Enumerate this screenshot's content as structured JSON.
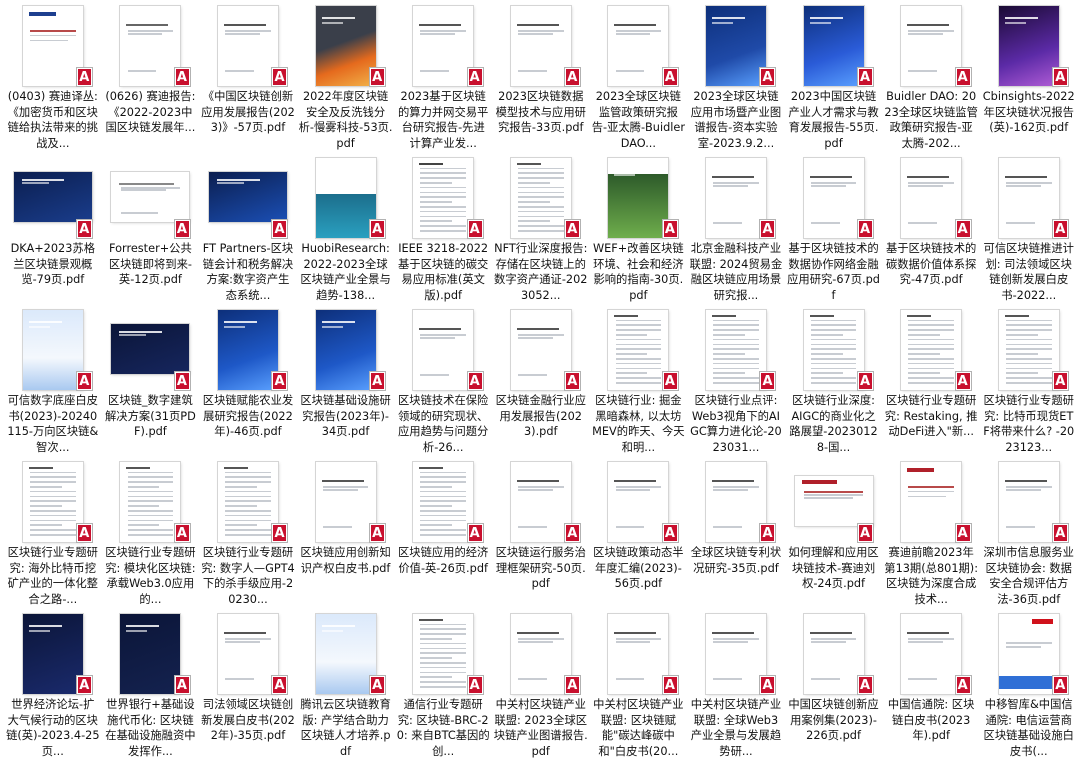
{
  "files": [
    {
      "name": "(0403) 赛迪译丛: 《加密货币和区块链给执法带来的挑战及...",
      "thumb": {
        "style": "report",
        "accent": "#1d3f8f"
      }
    },
    {
      "name": "(0626) 赛迪报告: 《2022-2023中国区块链发展年...",
      "thumb": {
        "style": "plain",
        "accent": "#666666"
      }
    },
    {
      "name": "《中国区块链创新应用发展报告(2023)》-57页.pdf",
      "thumb": {
        "style": "plain",
        "accent": "#555555"
      }
    },
    {
      "name": "2022年度区块链安全及反洗钱分析-慢雾科技-53页.pdf",
      "thumb": {
        "style": "orange",
        "accent": "#e56a1d"
      }
    },
    {
      "name": "2023基于区块链的算力并网交易平台研究报告-先进计算产业发...",
      "thumb": {
        "style": "plain",
        "accent": "#555555"
      }
    },
    {
      "name": "2023区块链数据模型技术与应用研究报告-33页.pdf",
      "thumb": {
        "style": "plain",
        "accent": "#555555"
      }
    },
    {
      "name": "2023全球区块链监管政策研究报告-亚太腾-Buidler DAO...",
      "thumb": {
        "style": "plain",
        "accent": "#555555"
      }
    },
    {
      "name": "2023全球区块链应用市场暨产业图谱报告-资本实验室-2023.9.2...",
      "thumb": {
        "style": "blue",
        "accent": "#1f4aa8"
      }
    },
    {
      "name": "2023中国区块链产业人才需求与教育发展报告-55页.pdf",
      "thumb": {
        "style": "blue",
        "accent": "#2a5bd7"
      }
    },
    {
      "name": "Buidler DAO: 2023全球区块链监管政策研究报告-亚太腾-202...",
      "thumb": {
        "style": "plain",
        "accent": "#555555"
      }
    },
    {
      "name": "Cbinsights-2022年区块链状况报告(英)-162页.pdf",
      "thumb": {
        "style": "purple",
        "accent": "#5b2aa6"
      }
    },
    {
      "name": "DKA+2023苏格兰区块链景观概览-79页.pdf",
      "thumb": {
        "style": "land-blue",
        "accent": "#1a3d8c"
      }
    },
    {
      "name": "Forrester+公共区块链即将到来-英-12页.pdf",
      "thumb": {
        "style": "land-plain",
        "accent": "#888888"
      }
    },
    {
      "name": "FT Partners-区块链会计和税务解决方案:数字资产生态系统...",
      "thumb": {
        "style": "land-blue",
        "accent": "#1b4fb5"
      }
    },
    {
      "name": "HuobiResearch: 2022-2023全球区块链产业全景与趋势-138...",
      "thumb": {
        "style": "teal",
        "accent": "#1c6e8c"
      }
    },
    {
      "name": "IEEE 3218-2022 基于区块链的碳交易应用标准(英文版).pdf",
      "thumb": {
        "style": "standard",
        "accent": "#444444"
      }
    },
    {
      "name": "NFT行业深度报告: 存储在区块链上的数字资产通证-2023052...",
      "thumb": {
        "style": "dense",
        "accent": "#555555"
      }
    },
    {
      "name": "WEF+改善区块链环境、社会和经济影响的指南-30页.pdf",
      "thumb": {
        "style": "green",
        "accent": "#3a7d2c"
      }
    },
    {
      "name": "北京金融科技产业联盟: 2024贸易金融区块链应用场景研究报...",
      "thumb": {
        "style": "plain",
        "accent": "#555555"
      }
    },
    {
      "name": "基于区块链技术的数据协作网络金融应用研究-67页.pdf",
      "thumb": {
        "style": "plain",
        "accent": "#555555"
      }
    },
    {
      "name": "基于区块链技术的碳数据价值体系探究-47页.pdf",
      "thumb": {
        "style": "plain",
        "accent": "#555555"
      }
    },
    {
      "name": "可信区块链推进计划: 司法领域区块链创新发展白皮书-2022...",
      "thumb": {
        "style": "plain",
        "accent": "#555555"
      }
    },
    {
      "name": "可信数字底座白皮书(2023)-20240115-万向区块链&智次...",
      "thumb": {
        "style": "lightblue",
        "accent": "#4a90e2"
      }
    },
    {
      "name": "区块链_数字建筑解决方案(31页PDF).pdf",
      "thumb": {
        "style": "land-navy",
        "accent": "#16265e"
      }
    },
    {
      "name": "区块链赋能农业发展研究报告(2022年)-46页.pdf",
      "thumb": {
        "style": "blue",
        "accent": "#1e58c7"
      }
    },
    {
      "name": "区块链基础设施研究报告(2023年)-34页.pdf",
      "thumb": {
        "style": "blue",
        "accent": "#1e58c7"
      }
    },
    {
      "name": "区块链技术在保险领域的研究现状、应用趋势与问题分析-26...",
      "thumb": {
        "style": "plain",
        "accent": "#555555"
      }
    },
    {
      "name": "区块链金融行业应用发展报告(2023).pdf",
      "thumb": {
        "style": "plain",
        "accent": "#555555"
      }
    },
    {
      "name": "区块链行业: 掘金黑暗森林, 以太坊MEV的昨天、今天和明...",
      "thumb": {
        "style": "dense",
        "accent": "#555555"
      }
    },
    {
      "name": "区块链行业点评: Web3视角下的AIGC算力进化论-2023031...",
      "thumb": {
        "style": "dense",
        "accent": "#555555"
      }
    },
    {
      "name": "区块链行业深度: AIGC的商业化之路展望-20230128-国...",
      "thumb": {
        "style": "dense",
        "accent": "#555555"
      }
    },
    {
      "name": "区块链行业专题研究: Restaking, 推动DeFi进入\"新...",
      "thumb": {
        "style": "dense",
        "accent": "#555555"
      }
    },
    {
      "name": "区块链行业专题研究: 比特币现货ETF将带来什么? -2023123...",
      "thumb": {
        "style": "dense",
        "accent": "#555555"
      }
    },
    {
      "name": "区块链行业专题研究: 海外比特币挖矿产业的一体化整合之路-...",
      "thumb": {
        "style": "dense",
        "accent": "#555555"
      }
    },
    {
      "name": "区块链行业专题研究: 模块化区块链: 承载Web3.0应用的...",
      "thumb": {
        "style": "dense",
        "accent": "#555555"
      }
    },
    {
      "name": "区块链行业专题研究: 数字人—GPT4下的杀手级应用-20230...",
      "thumb": {
        "style": "dense",
        "accent": "#555555"
      }
    },
    {
      "name": "区块链应用创新知识产权白皮书.pdf",
      "thumb": {
        "style": "plain",
        "accent": "#555555"
      }
    },
    {
      "name": "区块链应用的经济价值-英-26页.pdf",
      "thumb": {
        "style": "dense",
        "accent": "#555555"
      }
    },
    {
      "name": "区块链运行服务治理框架研究-50页.pdf",
      "thumb": {
        "style": "plain",
        "accent": "#555555"
      }
    },
    {
      "name": "区块链政策动态半年度汇编(2023)-56页.pdf",
      "thumb": {
        "style": "plain",
        "accent": "#555555"
      }
    },
    {
      "name": "全球区块链专利状况研究-35页.pdf",
      "thumb": {
        "style": "plain",
        "accent": "#555555"
      }
    },
    {
      "name": "如何理解和应用区块链技术-赛迪刘权-24页.pdf",
      "thumb": {
        "style": "land-report",
        "accent": "#b0202a"
      }
    },
    {
      "name": "赛迪前瞻2023年第13期(总801期): 区块链为深度合成技术...",
      "thumb": {
        "style": "report",
        "accent": "#b0202a"
      }
    },
    {
      "name": "深圳市信息服务业区块链协会: 数据安全合规评估方法-36页.pdf",
      "thumb": {
        "style": "plain",
        "accent": "#555555"
      }
    },
    {
      "name": "世界经济论坛-扩大气候行动的区块链(英)-2023.4-25页...",
      "thumb": {
        "style": "navy",
        "accent": "#1a2a6c"
      }
    },
    {
      "name": "世界银行+基础设施代币化: 区块链在基础设施融资中发挥作...",
      "thumb": {
        "style": "navy",
        "accent": "#14224f"
      }
    },
    {
      "name": "司法领域区块链创新发展白皮书(2022年)-35页.pdf",
      "thumb": {
        "style": "plain",
        "accent": "#555555"
      }
    },
    {
      "name": "腾讯云区块链教育版: 产学结合助力区块链人才培养.pdf",
      "thumb": {
        "style": "lightblue",
        "accent": "#3a78e0"
      }
    },
    {
      "name": "通信行业专题研究: 区块链-BRC-20: 来自BTC基因的创...",
      "thumb": {
        "style": "dense",
        "accent": "#555555"
      }
    },
    {
      "name": "中关村区块链产业联盟: 2023全球区块链产业图谱报告.pdf",
      "thumb": {
        "style": "plain",
        "accent": "#555555"
      }
    },
    {
      "name": "中关村区块链产业联盟: 区块链赋能\"碳达峰碳中和\"白皮书(20...",
      "thumb": {
        "style": "plain",
        "accent": "#555555"
      }
    },
    {
      "name": "中关村区块链产业联盟: 全球Web3产业全景与发展趋势研...",
      "thumb": {
        "style": "plain",
        "accent": "#555555"
      }
    },
    {
      "name": "中国区块链创新应用案例集(2023)-226页.pdf",
      "thumb": {
        "style": "plain",
        "accent": "#555555"
      }
    },
    {
      "name": "中国信通院: 区块链白皮书(2023年).pdf",
      "thumb": {
        "style": "plain",
        "accent": "#555555"
      }
    },
    {
      "name": "中移智库&中国信通院: 电信运营商区块链基础设施白皮书(...",
      "thumb": {
        "style": "caict",
        "accent": "#d0111b"
      }
    }
  ]
}
